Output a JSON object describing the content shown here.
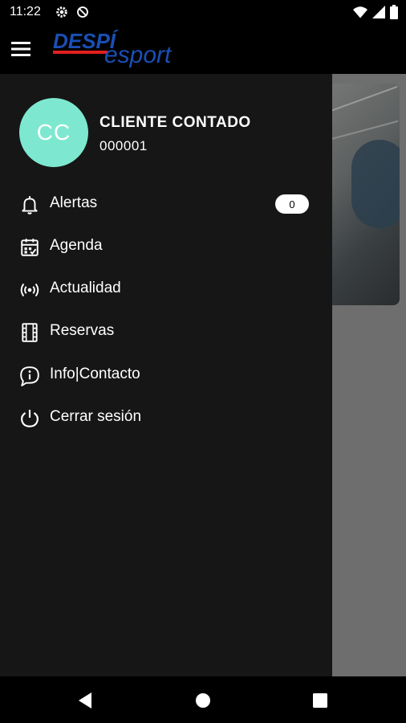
{
  "status_bar": {
    "time": "11:22",
    "left_icons": [
      "gear-icon",
      "no-disturb-icon"
    ],
    "right_icons": [
      "wifi-icon",
      "cell-signal-icon",
      "battery-icon"
    ]
  },
  "app_bar": {
    "logo_text_primary": "DESPÍ",
    "logo_text_secondary": "esport"
  },
  "drawer": {
    "avatar_initials": "CC",
    "user_name": "CLIENTE CONTADO",
    "user_id": "000001",
    "items": [
      {
        "label": "Alertas",
        "icon": "bell-icon",
        "badge": "0"
      },
      {
        "label": "Agenda",
        "icon": "calendar-icon"
      },
      {
        "label": "Actualidad",
        "icon": "broadcast-icon"
      },
      {
        "label": "Reservas",
        "icon": "film-icon"
      },
      {
        "label": "Info|Contacto",
        "icon": "info-chat-icon"
      },
      {
        "label": "Cerrar sesión",
        "icon": "power-icon"
      }
    ]
  },
  "colors": {
    "avatar_bg": "#7de8cf",
    "drawer_bg": "#161616",
    "logo_blue": "#1a4fb5",
    "logo_red": "#e0201f"
  },
  "nav_bar": {
    "buttons": [
      "back-icon",
      "home-icon",
      "recents-icon"
    ]
  }
}
